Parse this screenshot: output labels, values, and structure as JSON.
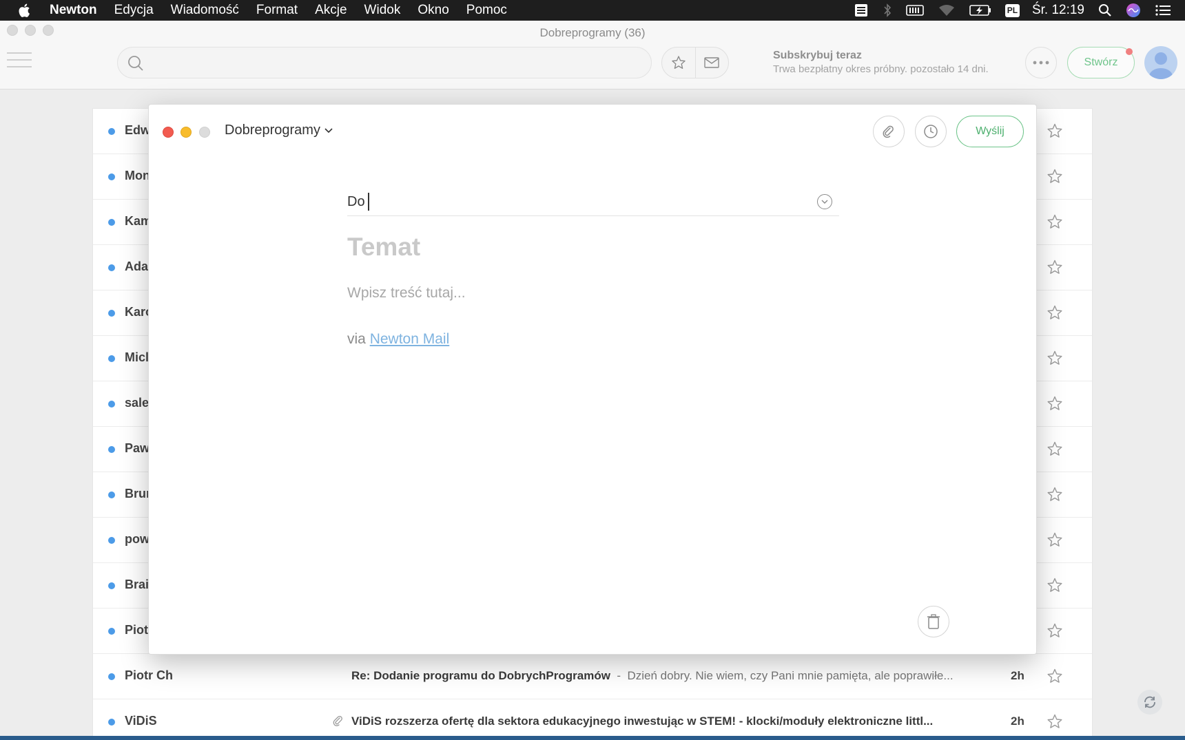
{
  "menubar": {
    "app_name": "Newton",
    "items": [
      "Edycja",
      "Wiadomość",
      "Format",
      "Akcje",
      "Widok",
      "Okno",
      "Pomoc"
    ],
    "input_source": "PL",
    "clock": "Śr. 12:19"
  },
  "window": {
    "title": "Dobreprogramy (36)",
    "search_placeholder": "",
    "subscribe_title": "Subskrybuj teraz",
    "subscribe_subtitle": "Trwa bezpłatny okres próbny. pozostało 14 dni.",
    "compose_label": "Stwórz"
  },
  "messages": [
    {
      "sender": "Edw",
      "subject": "",
      "preview": "",
      "time": "",
      "attachment": false
    },
    {
      "sender": "Mon",
      "subject": "",
      "preview": "",
      "time": "",
      "attachment": false
    },
    {
      "sender": "Kam",
      "subject": "",
      "preview": "",
      "time": "",
      "attachment": false
    },
    {
      "sender": "Ada",
      "subject": "",
      "preview": "",
      "time": "",
      "attachment": false
    },
    {
      "sender": "Karo",
      "subject": "",
      "preview": "",
      "time": "",
      "attachment": false
    },
    {
      "sender": "Micl",
      "subject": "",
      "preview": "",
      "time": "",
      "attachment": false
    },
    {
      "sender": "sale",
      "subject": "",
      "preview": "",
      "time": "",
      "attachment": false
    },
    {
      "sender": "Paw",
      "subject": "",
      "preview": "",
      "time": "",
      "attachment": false
    },
    {
      "sender": "Brun",
      "subject": "",
      "preview": "",
      "time": "",
      "attachment": false
    },
    {
      "sender": "pow",
      "subject": "",
      "preview": "",
      "time": "",
      "attachment": false
    },
    {
      "sender": "Brai",
      "subject": "",
      "preview": "",
      "time": "",
      "attachment": false
    },
    {
      "sender": "Piot",
      "subject": "",
      "preview": "",
      "time": "",
      "attachment": false
    },
    {
      "sender": "Piotr Ch",
      "subject": "Re: Dodanie programu do DobrychProgramów",
      "preview": "Dzień dobry. Nie wiem, czy Pani mnie pamięta, ale poprawiłe...",
      "time": "2h",
      "attachment": false
    },
    {
      "sender": "ViDiS",
      "subject": "ViDiS rozszerza ofertę dla sektora edukacyjnego inwestując w STEM! - klocki/moduły elektroniczne littl...",
      "preview": "",
      "time": "2h",
      "attachment": true
    }
  ],
  "compose": {
    "account": "Dobreprogramy",
    "send_label": "Wyślij",
    "to_label": "Do",
    "to_value": "",
    "subject_placeholder": "Temat",
    "body_placeholder": "Wpisz treść tutaj...",
    "signature_prefix": "via",
    "signature_link": "Newton Mail"
  },
  "colors": {
    "accent_green": "#4caf6d",
    "unread_dot": "#4c9be8",
    "link": "#7eb3e0"
  }
}
